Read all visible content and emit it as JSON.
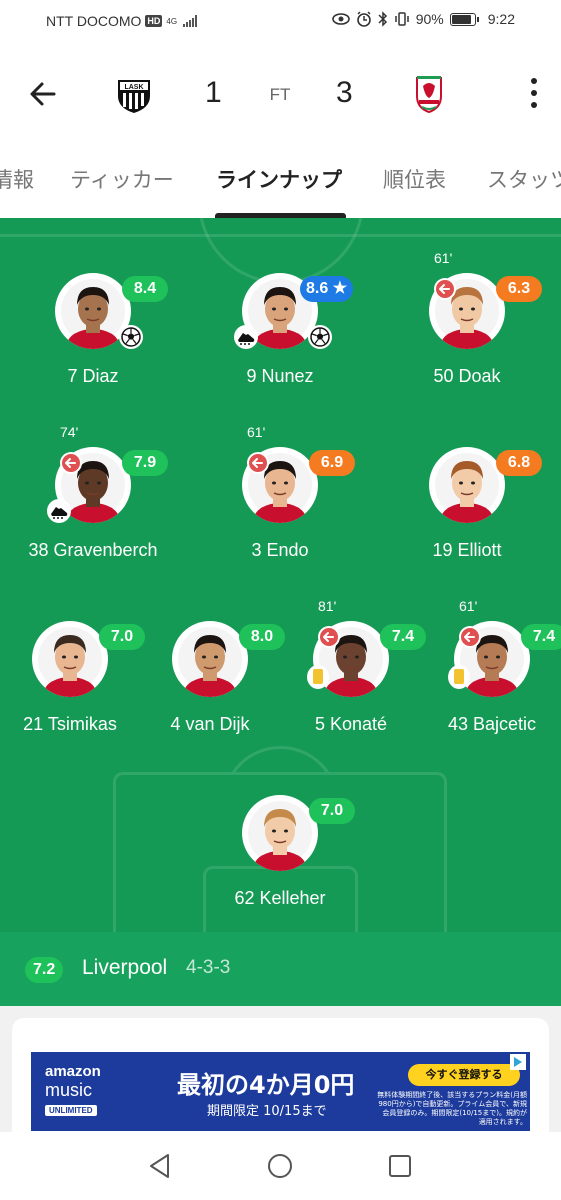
{
  "status_bar": {
    "carrier": "NTT DOCOMO",
    "hd": "HD",
    "network": "4G",
    "battery_percent": "90%",
    "battery_level": 0.9,
    "time": "9:22",
    "icons": [
      "eye-icon",
      "alarm-icon",
      "bluetooth-icon",
      "vibrate-icon",
      "battery-icon"
    ]
  },
  "header": {
    "home_team": "LASK",
    "home_score": "1",
    "status": "FT",
    "away_score": "3",
    "away_team": "Liverpool"
  },
  "tabs": [
    {
      "label": "情報",
      "active": false
    },
    {
      "label": "ティッカー",
      "active": false
    },
    {
      "label": "ラインナップ",
      "active": true
    },
    {
      "label": "順位表",
      "active": false
    },
    {
      "label": "スタッツ",
      "active": false
    }
  ],
  "colors": {
    "pitch": "#159a55",
    "rating_green": "#1ec15a",
    "rating_orange": "#f47b20",
    "rating_blue": "#1e7be6",
    "sub_out": "#e05050",
    "yellow_card": "#f2c230"
  },
  "lineup": {
    "players": [
      {
        "number_name": "7 Diaz",
        "rating": "8.4",
        "color": "green",
        "goal": true
      },
      {
        "number_name": "9 Nunez",
        "rating": "8.6",
        "color": "blue",
        "star": true,
        "assist": true,
        "goal": true
      },
      {
        "number_name": "50 Doak",
        "rating": "6.3",
        "color": "orange",
        "sub_minute": "61'"
      },
      {
        "number_name": "38 Gravenberch",
        "rating": "7.9",
        "color": "green",
        "sub_minute": "74'",
        "assist": true
      },
      {
        "number_name": "3 Endo",
        "rating": "6.9",
        "color": "orange",
        "sub_minute": "61'"
      },
      {
        "number_name": "19 Elliott",
        "rating": "6.8",
        "color": "orange"
      },
      {
        "number_name": "21 Tsimikas",
        "rating": "7.0",
        "color": "green"
      },
      {
        "number_name": "4 van Dijk",
        "rating": "8.0",
        "color": "green"
      },
      {
        "number_name": "5 Konaté",
        "rating": "7.4",
        "color": "green",
        "sub_minute": "81'",
        "yellow_card": true
      },
      {
        "number_name": "43 Bajcetic",
        "rating": "7.4",
        "color": "green",
        "sub_minute": "61'",
        "yellow_card": true
      },
      {
        "number_name": "62 Kelleher",
        "rating": "7.0",
        "color": "green"
      }
    ]
  },
  "team_bar": {
    "rating": "7.2",
    "name": "Liverpool",
    "formation": "4-3-3"
  },
  "ad": {
    "brand_line1": "amazon",
    "brand_line2": "music",
    "brand_line3": "UNLIMITED",
    "headline": "最初の4か月0円",
    "subline": "期間限定 10/15まで",
    "cta": "今すぐ登録する",
    "fine_print": "無料体験期間終了後、該当するプラン料金(月額980円から)で自動更新。プライム会員で、新規会員登録のみ。期間限定(10/15まで)。規約が適用されます。"
  },
  "navbar": {
    "icons": [
      "back-triangle-icon",
      "home-circle-icon",
      "recents-square-icon"
    ]
  }
}
